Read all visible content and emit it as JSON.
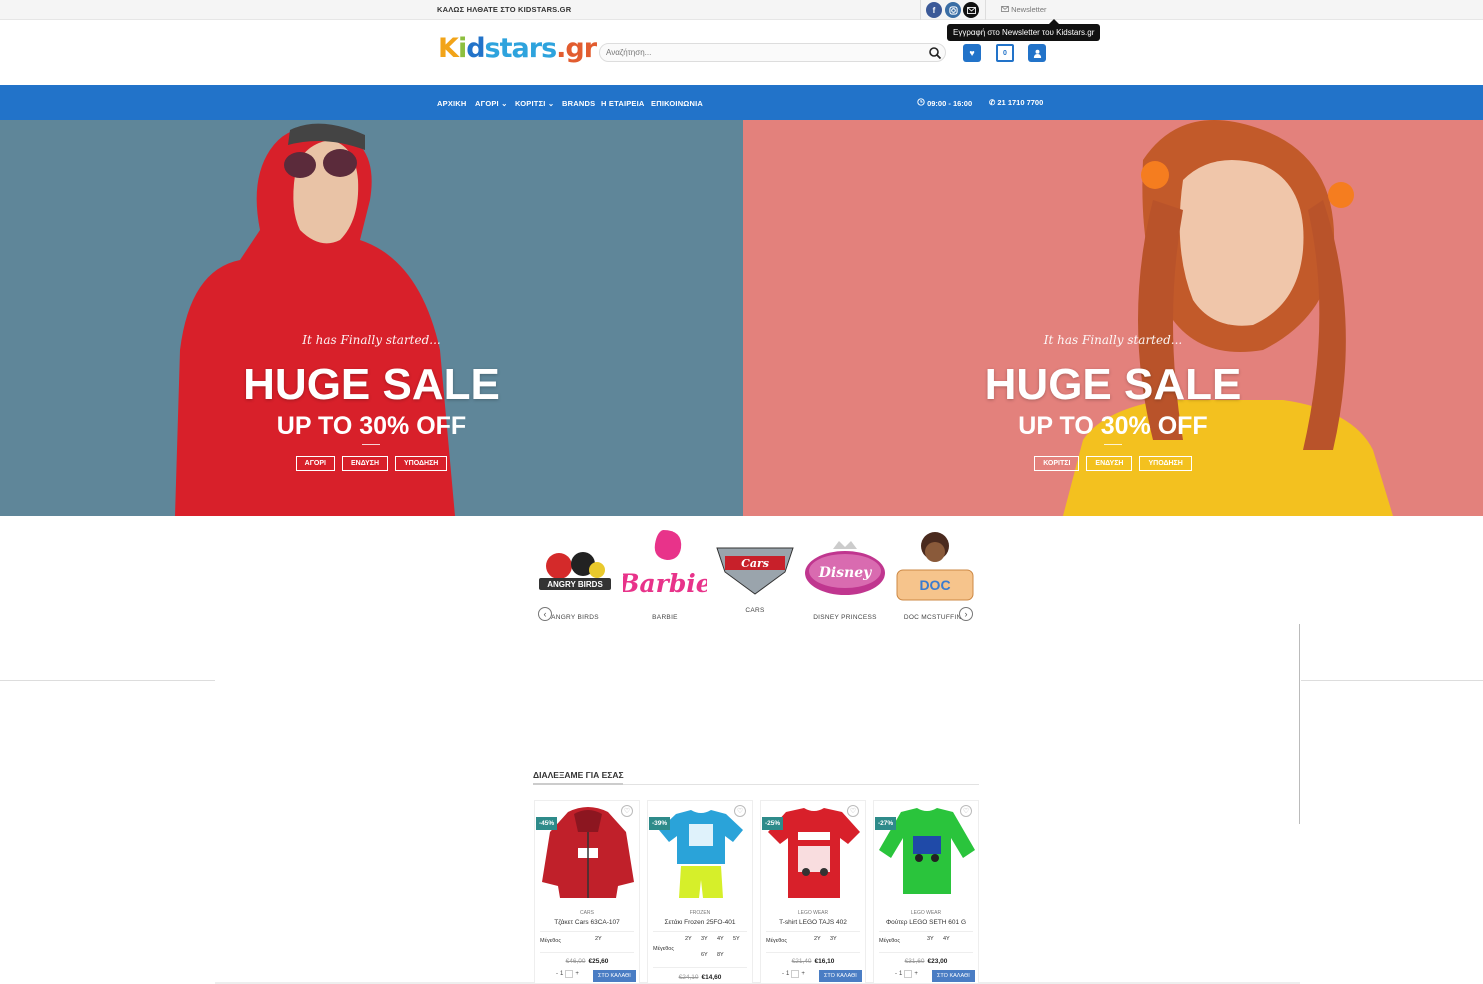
{
  "topbar": {
    "welcome": "ΚΑΛΩΣ ΗΛΘΑΤΕ ΣΤΟ KIDSTARS.GR",
    "newsletter": "Newsletter",
    "tooltip": "Εγγραφή στο Newsletter του Kidstars.gr",
    "social_icons": [
      "facebook-icon",
      "instagram-icon",
      "email-icon"
    ]
  },
  "header": {
    "logo": "Kidstars.gr",
    "search_placeholder": "Αναζήτηση...",
    "cart_count": "0"
  },
  "nav": {
    "items": [
      "ΑΡΧΙΚΗ",
      "ΑΓΟΡΙ",
      "ΚΟΡΙΤΣΙ",
      "BRANDS",
      "Η ΕΤΑΙΡΕΙΑ",
      "ΕΠΙΚΟΙΝΩΝΙΑ"
    ],
    "hours": "09:00 - 16:00",
    "phone": "21 1710 7700",
    "accent": "#2273c9"
  },
  "hero": [
    {
      "tagline": "It has Finally started...",
      "title": "HUGE SALE",
      "subtitle": "UP TO 30% OFF",
      "buttons": [
        "ΑΓΟΡΙ",
        "ΕΝΔΥΣΗ",
        "ΥΠΟΔΗΣΗ"
      ]
    },
    {
      "tagline": "It has Finally started...",
      "title": "HUGE SALE",
      "subtitle": "UP TO 30% OFF",
      "buttons": [
        "ΚΟΡΙΤΣΙ",
        "ΕΝΔΥΣΗ",
        "ΥΠΟΔΗΣΗ"
      ]
    }
  ],
  "brands": [
    {
      "name": "ANGRY BIRDS"
    },
    {
      "name": "BARBIE"
    },
    {
      "name": "CARS"
    },
    {
      "name": "DISNEY PRINCESS"
    },
    {
      "name": "DOC MCSTUFFINS"
    }
  ],
  "picked": {
    "title": "ΔΙΑΛΕΞΑΜΕ ΓΙΑ ΕΣΑΣ",
    "size_label": "Μέγεθος",
    "add_to_cart": "ΣΤΟ ΚΑΛΑΘΙ",
    "qty": "1",
    "products": [
      {
        "badge": "-45%",
        "brand": "CARS",
        "name": "Τζάκετ Cars 63CA-107",
        "sizes": [
          "2Y"
        ],
        "old_price": "€46,00",
        "price": "€25,60"
      },
      {
        "badge": "-39%",
        "brand": "FROZEN",
        "name": "Σετάκι Frozen 25FO-401",
        "sizes": [
          "2Y",
          "3Y",
          "4Y",
          "5Y",
          "6Y",
          "8Y"
        ],
        "old_price": "€24,10",
        "price": "€14,60"
      },
      {
        "badge": "-25%",
        "brand": "LEGO WEAR",
        "name": "T-shirt LEGO TAJS 402",
        "sizes": [
          "2Y",
          "3Y"
        ],
        "old_price": "€21,40",
        "price": "€16,10"
      },
      {
        "badge": "-27%",
        "brand": "LEGO WEAR",
        "name": "Φούτερ LEGO SETH 601 G",
        "sizes": [
          "3Y",
          "4Y"
        ],
        "old_price": "€31,60",
        "price": "€23,00"
      }
    ]
  }
}
